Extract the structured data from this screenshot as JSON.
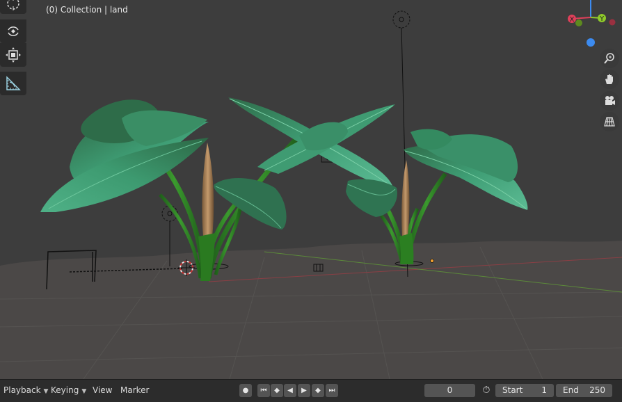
{
  "viewport": {
    "info_label": "(0) Collection | land",
    "tools": [
      {
        "name": "cursor-tool",
        "active": false
      },
      {
        "name": "rotate-tool",
        "active": false
      },
      {
        "name": "scale-tool",
        "active": false
      },
      {
        "name": "measure-tool",
        "active": true
      }
    ],
    "gizmo": {
      "x_label": "X",
      "y_label": "Y",
      "x_color": "#e0405a",
      "y_color": "#8fca2a",
      "z_color": "#3c8bf0"
    },
    "nav_buttons": [
      "zoom-icon",
      "hand-pan-icon",
      "camera-icon",
      "grid-perspective-icon"
    ]
  },
  "timeline": {
    "playback": "Playback",
    "keying": "Keying",
    "view": "View",
    "marker": "Marker",
    "current_frame": "0",
    "start_label": "Start",
    "start_value": "1",
    "end_label": "End",
    "end_value": "250"
  },
  "colors": {
    "background": "#3d3d3d",
    "floor": "#4a4847",
    "leaf": "#3e9c72",
    "stem": "#2c7d22",
    "panel": "#2c2c2c",
    "active_tool": "#5680c2"
  }
}
